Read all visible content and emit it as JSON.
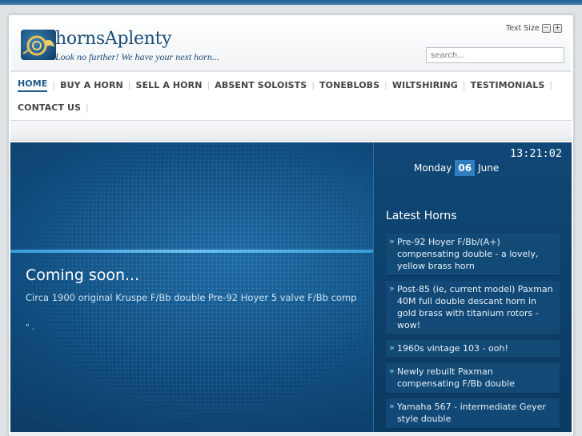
{
  "header": {
    "site_title": "hornsAplenty",
    "tagline": "Look no further! We have your next horn...",
    "text_size_label": "Text Size",
    "text_size_minus": "−",
    "text_size_plus": "+",
    "search_placeholder": "search..."
  },
  "nav": {
    "row1": [
      "HOME",
      "BUY A HORN",
      "SELL A HORN",
      "ABSENT SOLOISTS",
      "TONEBLOBS",
      "WILTSHIRING",
      "TESTIMONIALS"
    ],
    "row2": [
      "CONTACT US"
    ],
    "active": "HOME"
  },
  "hero": {
    "title": "Coming soon...",
    "description": "Circa 1900 original Kruspe F/Bb double Pre-92 Hoyer 5 valve F/Bb comp",
    "more": "\" ."
  },
  "sidebar": {
    "time": "13:21:02",
    "weekday": "Monday",
    "day": "06",
    "month": "June",
    "latest_title": "Latest Horns",
    "latest_items": [
      "Pre-92 Hoyer F/Bb/(A+) compensating double - a lovely, yellow brass horn",
      "Post-85 (ie, current model) Paxman 40M full double descant horn in gold brass with titanium rotors - wow!",
      "1960s vintage 103 - ooh!",
      "Newly rebuilt Paxman compensating F/Bb double",
      "Yamaha 567 - intermediate Geyer style double"
    ]
  },
  "colors": {
    "brand": "#1b4d79",
    "hero_bg": "#0f4a7b",
    "accent": "#2f7ec0"
  }
}
